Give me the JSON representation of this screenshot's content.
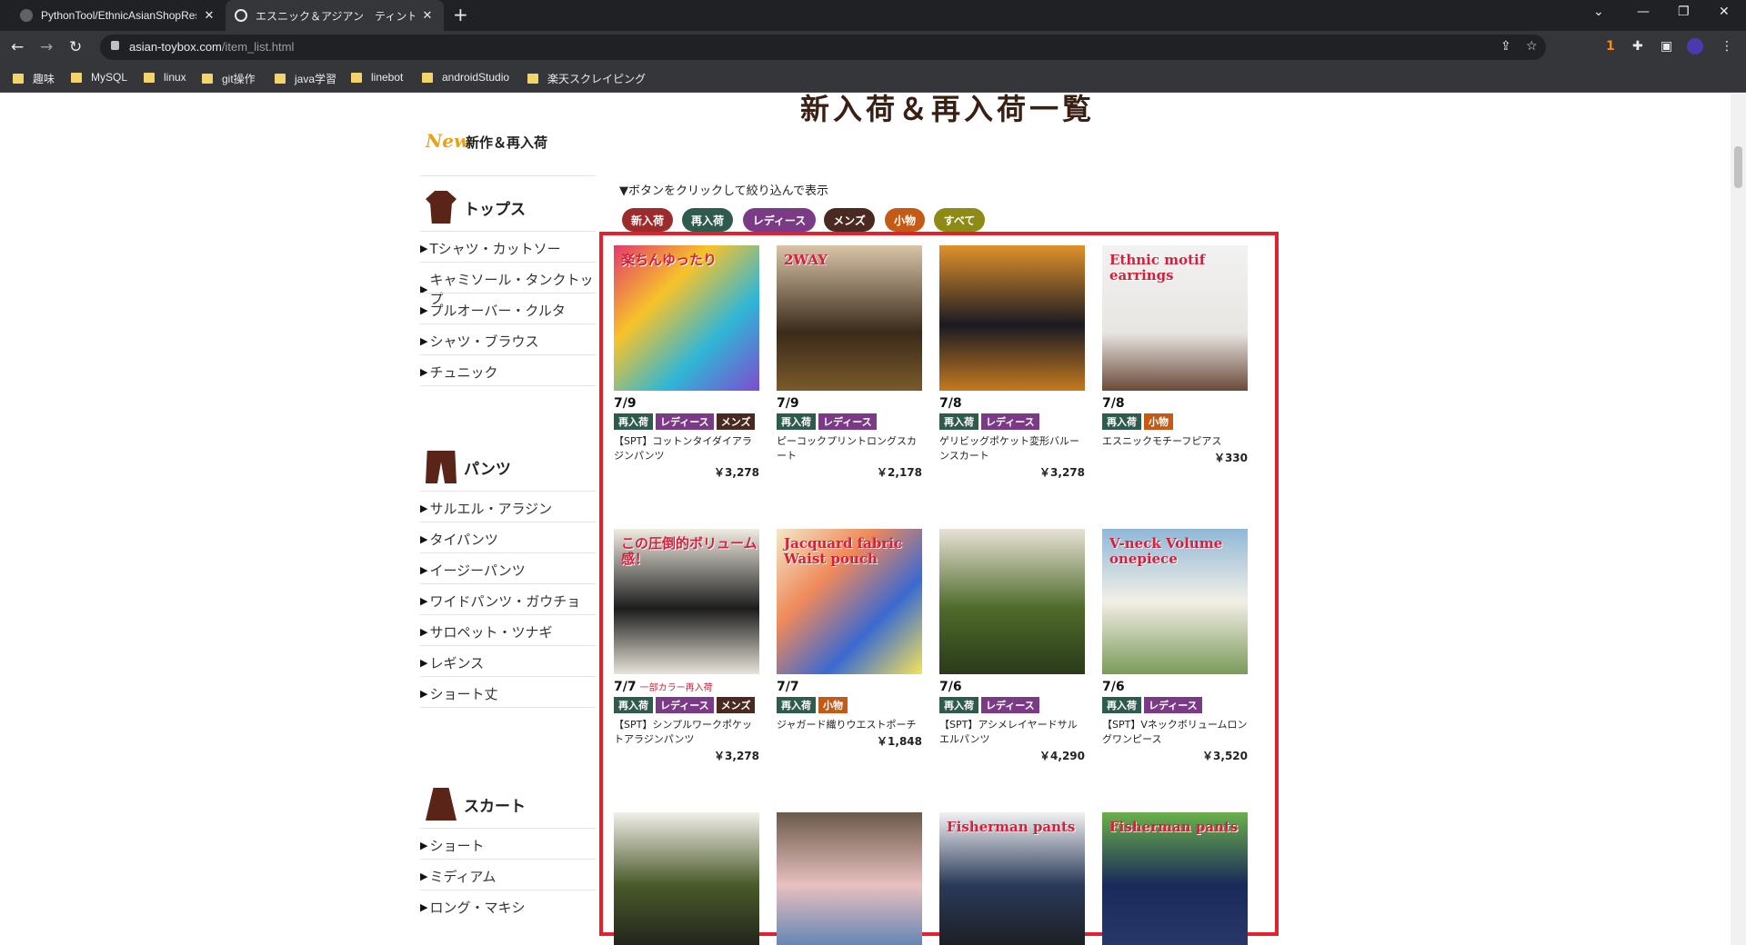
{
  "browser": {
    "tabs": [
      {
        "title": "PythonTool/EthnicAsianShopRese",
        "active": false
      },
      {
        "title": "エスニック＆アジアン　ティントン本店",
        "active": true
      }
    ],
    "url_host": "asian-toybox.com",
    "url_path": "/item_list.html",
    "bookmarks": [
      "趣味",
      "MySQL",
      "linux",
      "git操作",
      "java学習",
      "linebot",
      "androidStudio",
      "楽天スクレイピング"
    ],
    "extension_badge": "1"
  },
  "page": {
    "heading": "新入荷＆再入荷一覧",
    "new_badge": "New",
    "new_label": "新作＆再入荷",
    "filter_note": "▼ボタンをクリックして絞り込んで表示",
    "filters": [
      {
        "label": "新入荷",
        "color": "#9c2b2b"
      },
      {
        "label": "再入荷",
        "color": "#2f5a4e"
      },
      {
        "label": "レディース",
        "color": "#7b3a86"
      },
      {
        "label": "メンズ",
        "color": "#4a2a20"
      },
      {
        "label": "小物",
        "color": "#c45a16"
      },
      {
        "label": "すべて",
        "color": "#8d8a16"
      }
    ]
  },
  "sidebar": {
    "categories": [
      {
        "title": "トップス",
        "icon": "shirt-icon",
        "items": [
          "Tシャツ・カットソー",
          "キャミソール・タンクトップ",
          "プルオーバー・クルタ",
          "シャツ・ブラウス",
          "チュニック"
        ]
      },
      {
        "title": "パンツ",
        "icon": "pants-icon",
        "items": [
          "サルエル・アラジン",
          "タイパンツ",
          "イージーパンツ",
          "ワイドパンツ・ガウチョ",
          "サロペット・ツナギ",
          "レギンス",
          "ショート丈"
        ]
      },
      {
        "title": "スカート",
        "icon": "skirt-icon",
        "items": [
          "ショート",
          "ミディアム",
          "ロング・マキシ"
        ]
      }
    ]
  },
  "tag_colors": {
    "再入荷": "#2f5a4e",
    "レディース": "#7b3a86",
    "メンズ": "#4a2a20",
    "小物": "#c45a16"
  },
  "items": [
    {
      "date": "7/9",
      "note": "",
      "tags": [
        "再入荷",
        "レディース",
        "メンズ"
      ],
      "name": "【SPT】コットンタイダイアラジンパンツ",
      "price": "￥3,278",
      "thumb_text": "楽ちんゆったり",
      "thumb_bg": "linear-gradient(135deg,#e33a6d,#f7c32a,#2fb7d6,#7c4ccf)"
    },
    {
      "date": "7/9",
      "note": "",
      "tags": [
        "再入荷",
        "レディース"
      ],
      "name": "ピーコックプリントロングスカート",
      "price": "￥2,178",
      "thumb_text": "2WAY",
      "thumb_bg": "linear-gradient(180deg,#d9c4a8,#3a2a1a 60%,#7a5a2a)"
    },
    {
      "date": "7/8",
      "note": "",
      "tags": [
        "再入荷",
        "レディース"
      ],
      "name": "ゲリビッグポケット変形バルーンスカート",
      "price": "￥3,278",
      "thumb_text": "",
      "thumb_bg": "linear-gradient(180deg,#e0922a,#1a1a22 55%,#c47a20)"
    },
    {
      "date": "7/8",
      "note": "",
      "tags": [
        "再入荷",
        "小物"
      ],
      "name": "エスニックモチーフピアス",
      "price": "￥330",
      "thumb_text": "Ethnic motif earrings",
      "thumb_bg": "linear-gradient(180deg,#f2f2f2,#e8e6e2 60%,#6a4a3a)"
    },
    {
      "date": "7/7",
      "note": "一部カラー再入荷",
      "tags": [
        "再入荷",
        "レディース",
        "メンズ"
      ],
      "name": "【SPT】シンプルワークポケットアラジンパンツ",
      "price": "￥3,278",
      "thumb_text": "この圧倒的ボリューム感！",
      "thumb_bg": "linear-gradient(180deg,#f1ece2,#1c1c1c 55%,#e9e4da)"
    },
    {
      "date": "7/7",
      "note": "",
      "tags": [
        "再入荷",
        "小物"
      ],
      "name": "ジャガード織りウエストポーチ",
      "price": "￥1,848",
      "thumb_text": "Jacquard fabric Waist pouch",
      "thumb_bg": "linear-gradient(135deg,#f2e8c8,#f08a5a,#3a6ad0,#f5e35a)"
    },
    {
      "date": "7/6",
      "note": "",
      "tags": [
        "再入荷",
        "レディース"
      ],
      "name": "【SPT】アシメレイヤードサルエルパンツ",
      "price": "￥4,290",
      "thumb_text": "",
      "thumb_bg": "linear-gradient(180deg,#e8e2d6,#4e6a2a 55%,#2a3a1a)"
    },
    {
      "date": "7/6",
      "note": "",
      "tags": [
        "再入荷",
        "レディース"
      ],
      "name": "【SPT】Vネックボリュームロングワンピース",
      "price": "￥3,520",
      "thumb_text": "V-neck Volume onepiece",
      "thumb_bg": "linear-gradient(180deg,#8fb8d8,#f3efe6 50%,#7a9a5a)"
    },
    {
      "date": "",
      "note": "",
      "tags": [],
      "name": "",
      "price": "",
      "thumb_text": "",
      "thumb_bg": "linear-gradient(180deg,#f2efe8,#4a5a2a 50%,#1a1a1a)"
    },
    {
      "date": "",
      "note": "",
      "tags": [],
      "name": "",
      "price": "",
      "thumb_text": "",
      "thumb_bg": "linear-gradient(180deg,#6a5a4a,#e8c0c0 50%,#4a7ab0)"
    },
    {
      "date": "",
      "note": "",
      "tags": [],
      "name": "",
      "price": "",
      "thumb_text": "Fisherman pants",
      "thumb_bg": "linear-gradient(180deg,#f2f2f2,#2a3a5a 50%,#1a1a1a)"
    },
    {
      "date": "",
      "note": "",
      "tags": [],
      "name": "",
      "price": "",
      "thumb_text": "Fisherman pants",
      "thumb_bg": "linear-gradient(180deg,#6ab04a,#1a2a5a 50%,#2a3a6a)"
    }
  ]
}
